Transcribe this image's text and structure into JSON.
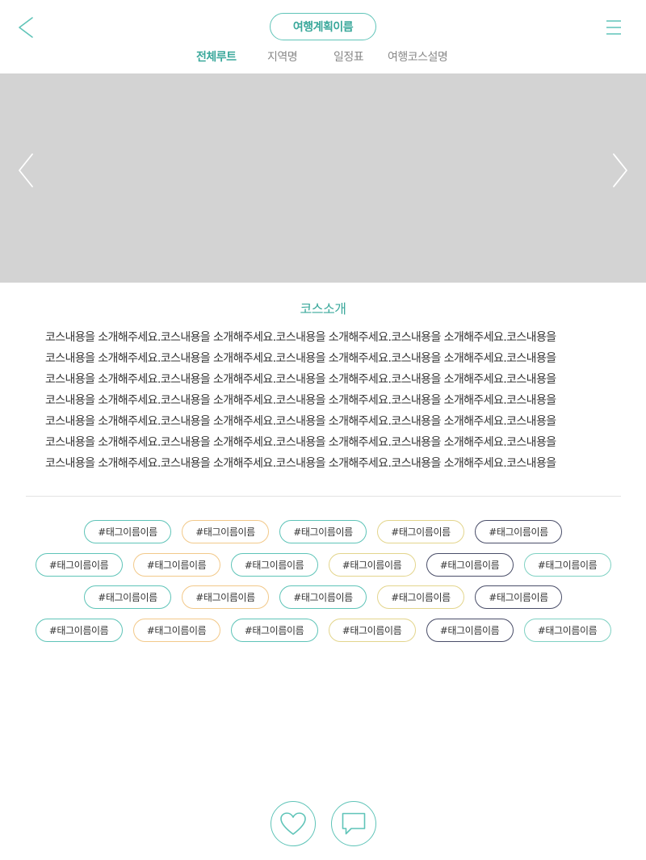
{
  "header": {
    "title": "여행계획이름",
    "back_icon": "chevron-left-icon",
    "menu_icon": "hamburger-menu-icon"
  },
  "tabs": [
    {
      "label": "전체루트",
      "active": true
    },
    {
      "label": "지역명",
      "active": false
    },
    {
      "label": "일정표",
      "active": false
    },
    {
      "label": "여행코스설명",
      "active": false
    }
  ],
  "carousel": {
    "prev_icon": "chevron-left-icon",
    "next_icon": "chevron-right-icon"
  },
  "intro": {
    "title": "코스소개",
    "lines": [
      "코스내용을 소개해주세요.코스내용을 소개해주세요.코스내용을 소개해주세요.코스내용을 소개해주세요.코스내용을",
      "코스내용을 소개해주세요.코스내용을 소개해주세요.코스내용을 소개해주세요.코스내용을 소개해주세요.코스내용을",
      "코스내용을 소개해주세요.코스내용을 소개해주세요.코스내용을 소개해주세요.코스내용을 소개해주세요.코스내용을",
      "코스내용을 소개해주세요.코스내용을 소개해주세요.코스내용을 소개해주세요.코스내용을 소개해주세요.코스내용을",
      "코스내용을 소개해주세요.코스내용을 소개해주세요.코스내용을 소개해주세요.코스내용을 소개해주세요.코스내용을",
      "코스내용을 소개해주세요.코스내용을 소개해주세요.코스내용을 소개해주세요.코스내용을 소개해주세요.코스내용을",
      "코스내용을 소개해주세요.코스내용을 소개해주세요.코스내용을 소개해주세요.코스내용을 소개해주세요.코스내용을"
    ]
  },
  "tags": {
    "rows": [
      [
        {
          "label": "#태그이름이름",
          "color": "#5fc4b8"
        },
        {
          "label": "#태그이름이름",
          "color": "#f2c98a"
        },
        {
          "label": "#태그이름이름",
          "color": "#5fc4b8"
        },
        {
          "label": "#태그이름이름",
          "color": "#e3d58d"
        },
        {
          "label": "#태그이름이름",
          "color": "#4a4e69"
        }
      ],
      [
        {
          "label": "#태그이름이름",
          "color": "#5fc4b8"
        },
        {
          "label": "#태그이름이름",
          "color": "#f2c98a"
        },
        {
          "label": "#태그이름이름",
          "color": "#5fc4b8"
        },
        {
          "label": "#태그이름이름",
          "color": "#e3d58d"
        },
        {
          "label": "#태그이름이름",
          "color": "#4a4e69"
        },
        {
          "label": "#태그이름이름",
          "color": "#7fd1c3"
        }
      ],
      [
        {
          "label": "#태그이름이름",
          "color": "#5fc4b8"
        },
        {
          "label": "#태그이름이름",
          "color": "#f2c98a"
        },
        {
          "label": "#태그이름이름",
          "color": "#5fc4b8"
        },
        {
          "label": "#태그이름이름",
          "color": "#e3d58d"
        },
        {
          "label": "#태그이름이름",
          "color": "#4a4e69"
        }
      ],
      [
        {
          "label": "#태그이름이름",
          "color": "#5fc4b8"
        },
        {
          "label": "#태그이름이름",
          "color": "#f2c98a"
        },
        {
          "label": "#태그이름이름",
          "color": "#5fc4b8"
        },
        {
          "label": "#태그이름이름",
          "color": "#e3d58d"
        },
        {
          "label": "#태그이름이름",
          "color": "#4a4e69"
        },
        {
          "label": "#태그이름이름",
          "color": "#7fd1c3"
        }
      ]
    ]
  },
  "actions": {
    "like_icon": "heart-icon",
    "comment_icon": "speech-bubble-icon"
  },
  "colors": {
    "accent": "#3aa89b",
    "accent_border": "#5fc4b8",
    "carousel_bg": "#d3d3d3",
    "divider": "#e2e2e2",
    "text": "#333333",
    "tab_inactive": "#888888"
  }
}
